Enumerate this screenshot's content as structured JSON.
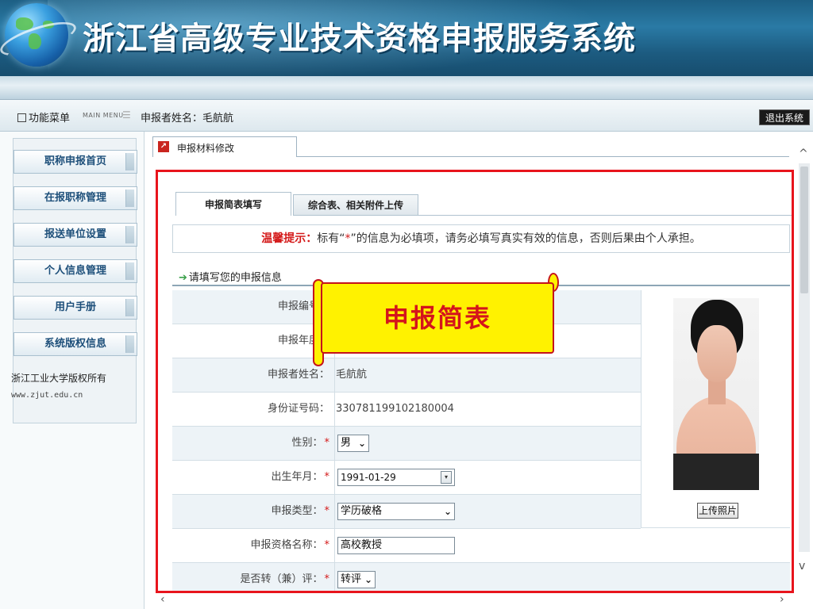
{
  "header": {
    "title": "浙江省高级专业技术资格申报服务系统"
  },
  "menubar": {
    "menu_label": "功能菜单",
    "main_menu": "MAIN MENU",
    "applicant": "申报者姓名：毛航航",
    "logout": "退出系统"
  },
  "sidebar": {
    "items": [
      {
        "label": "职称申报首页"
      },
      {
        "label": "在报职称管理"
      },
      {
        "label": "报送单位设置"
      },
      {
        "label": "个人信息管理"
      },
      {
        "label": "用户手册"
      },
      {
        "label": "系统版权信息"
      }
    ],
    "copyright": "浙江工业大学版权所有",
    "site": "www.zjut.edu.cn"
  },
  "main": {
    "tab": "申报材料修改",
    "subtabs": [
      "申报简表填写",
      "综合表、相关附件上传"
    ],
    "notice": {
      "prefix": "温馨提示：",
      "text1": "标有“",
      "star": "*",
      "text2": "”的信息为必填项，请务必填写真实有效的信息，否则后果由个人承担。"
    },
    "section_title": "请填写您的申报信息",
    "callout": "申报简表",
    "form": {
      "serial_label": "申报编号：",
      "year_label": "申报年度：",
      "name_label": "申报者姓名：",
      "name_value": "毛航航",
      "id_label": "身份证号码：",
      "id_value": "330781199102180004",
      "gender_label": "性别：",
      "gender_value": "男",
      "birth_label": "出生年月：",
      "birth_value": "1991-01-29",
      "type_label": "申报类型：",
      "type_value": "学历破格",
      "qual_label": "申报资格名称：",
      "qual_value": "高校教授",
      "transfer_label": "是否转（兼）评：",
      "transfer_value": "转评",
      "required_mark": "*"
    },
    "upload_photo": "上传照片"
  }
}
